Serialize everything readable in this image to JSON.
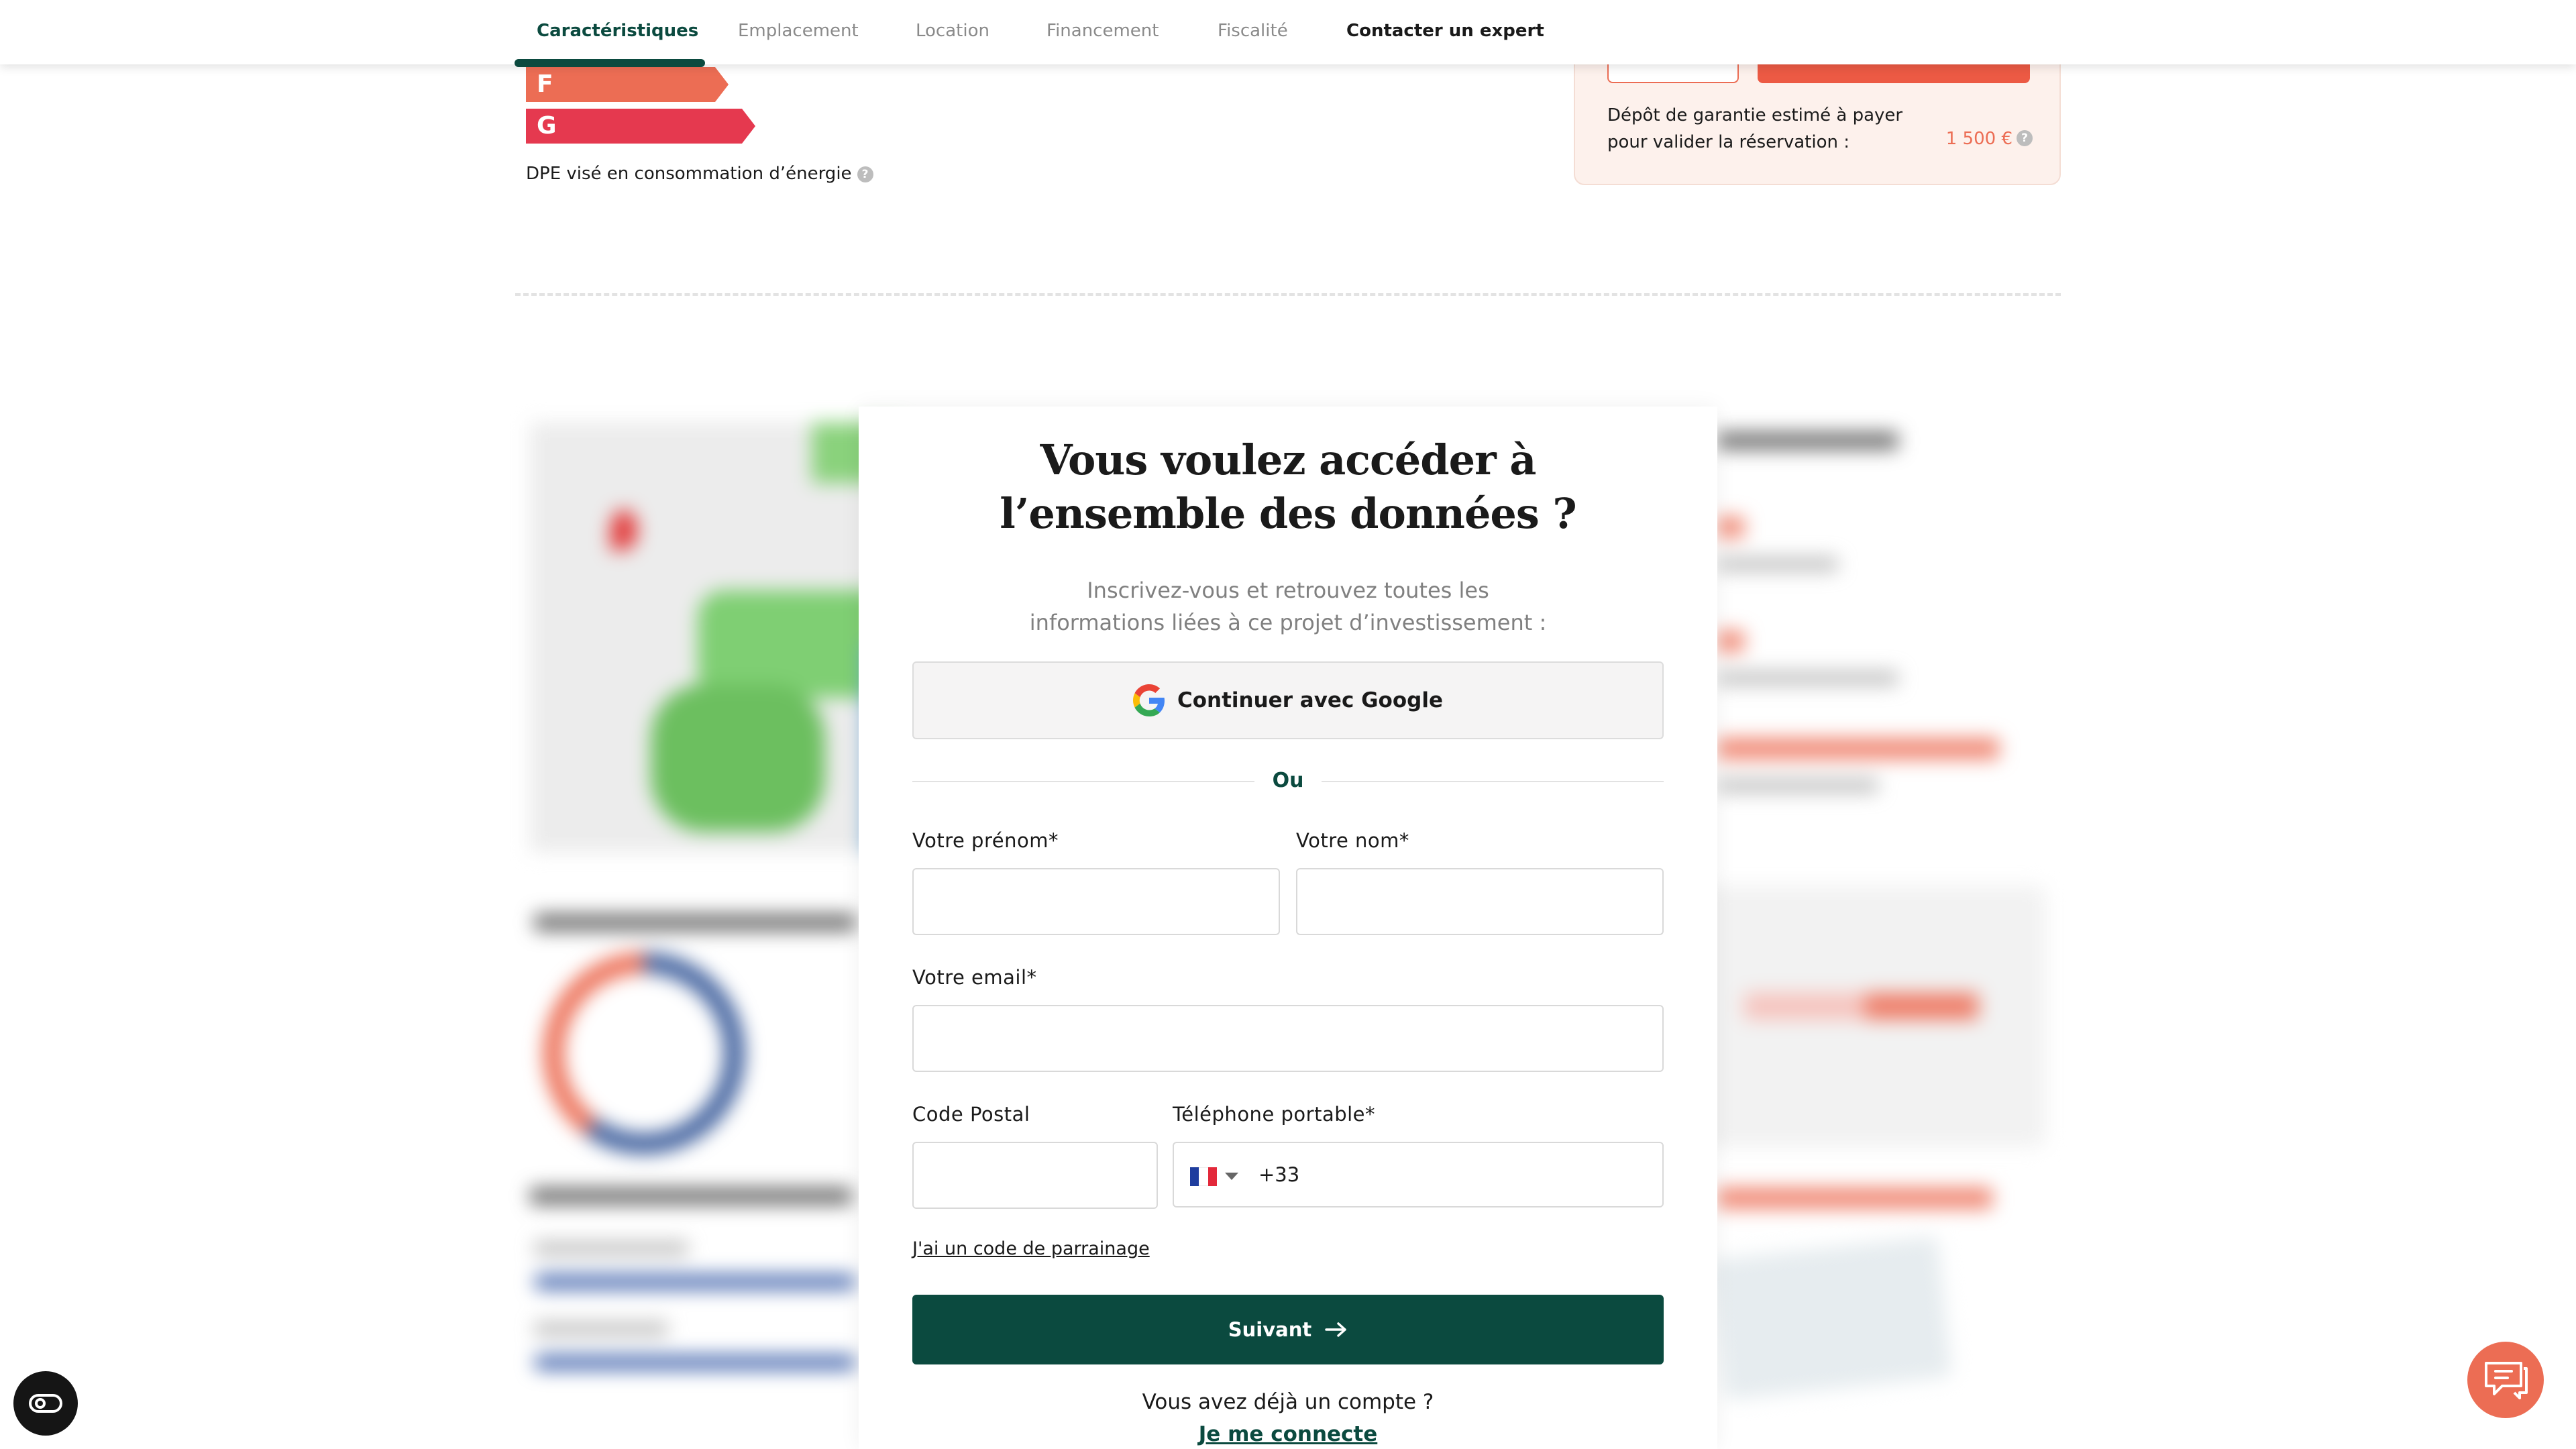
{
  "nav": {
    "items": [
      {
        "label": "Caractéristiques"
      },
      {
        "label": "Emplacement"
      },
      {
        "label": "Location"
      },
      {
        "label": "Financement"
      },
      {
        "label": "Fiscalité"
      },
      {
        "label": "Contacter un expert"
      }
    ],
    "active_index": 0
  },
  "dpe": {
    "labels": [
      "F",
      "G"
    ],
    "caption": "DPE visé en consommation d’énergie",
    "help": "?"
  },
  "reservation": {
    "text": "Dépôt de garantie estimé à payer pour valider la réservation :",
    "amount": "1 500 €",
    "help": "?"
  },
  "modal": {
    "title_line1": "Vous voulez accéder à",
    "title_line2": "l’ensemble des données ?",
    "subtitle_line1": "Inscrivez-vous et retrouvez toutes les",
    "subtitle_line2": "informations liées à ce projet d’investissement :",
    "google_label": "Continuer avec Google",
    "divider": "Ou",
    "fields": {
      "firstname_label": "Votre prénom*",
      "lastname_label": "Votre nom*",
      "email_label": "Votre email*",
      "postal_label": "Code Postal",
      "phone_label": "Téléphone portable*",
      "firstname_value": "",
      "lastname_value": "",
      "email_value": "",
      "postal_value": "",
      "phone_prefix": "+33",
      "phone_value": ""
    },
    "referral": "J'ai un code de parrainage",
    "submit": "Suivant",
    "account_question": "Vous avez déjà un compte ?",
    "login": "Je me connecte"
  },
  "colors": {
    "brand_green": "#0b4a3f",
    "accent_orange": "#ec6d54",
    "dpe_f": "#ec6d54",
    "dpe_g": "#e5394f"
  },
  "icons": {
    "google": "google-g-icon",
    "submit_arrow": "arrow-right-icon",
    "help": "question-mark-icon",
    "accessibility": "accessibility-toggle-icon",
    "chat": "chat-bubble-icon",
    "flag": "france-flag-icon",
    "caret": "chevron-down-icon"
  }
}
